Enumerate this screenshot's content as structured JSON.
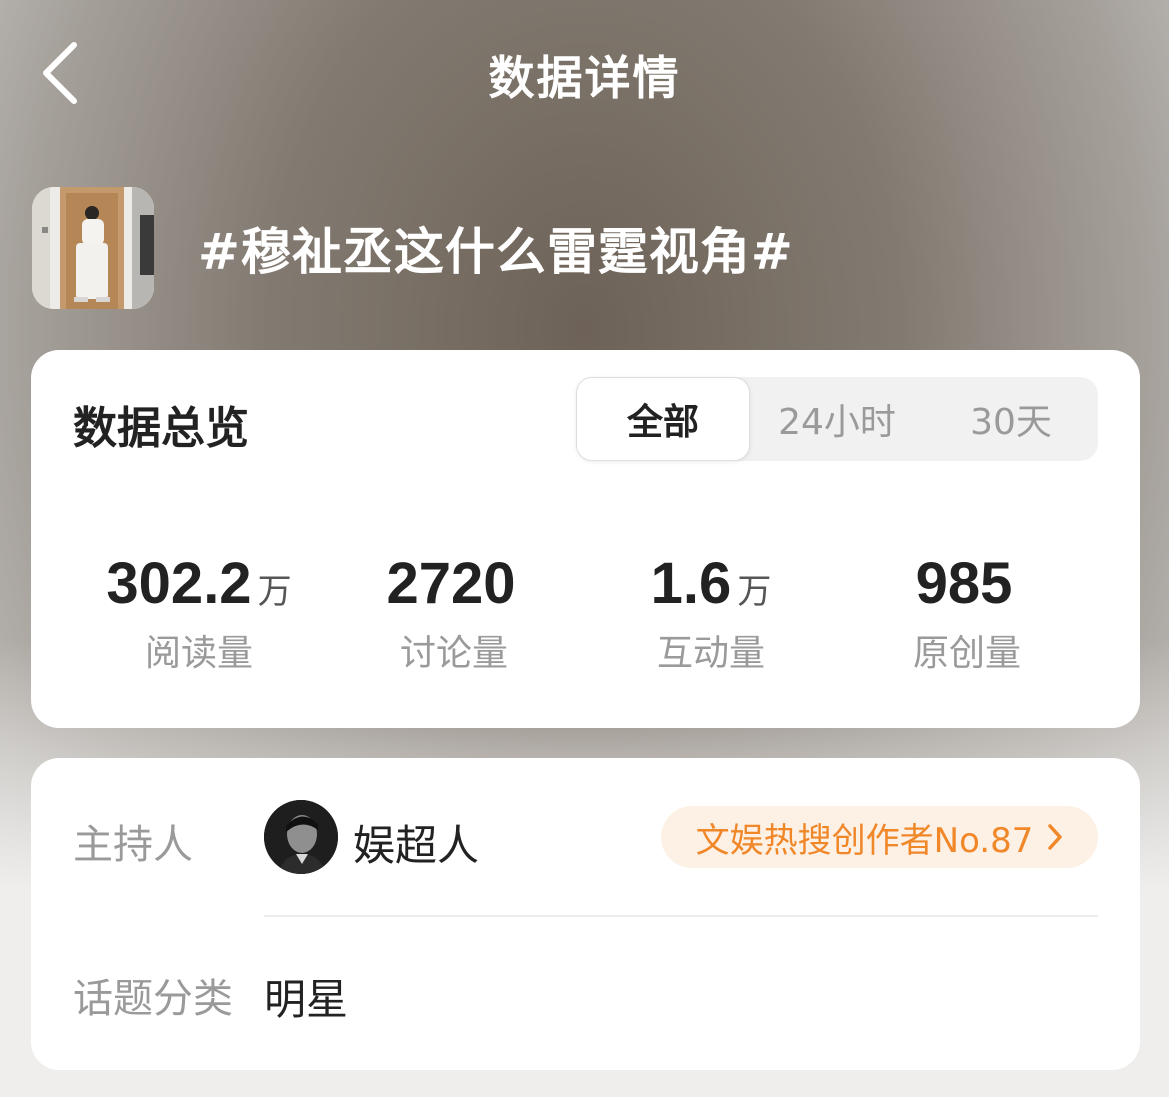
{
  "header": {
    "title": "数据详情",
    "back_icon": "chevron-left-icon"
  },
  "topic": {
    "title": "#穆祉丞这什么雷霆视角#"
  },
  "overview": {
    "title": "数据总览",
    "tabs": [
      {
        "label": "全部",
        "active": true
      },
      {
        "label": "24小时",
        "active": false
      },
      {
        "label": "30天",
        "active": false
      }
    ],
    "stats": [
      {
        "value": "302.2",
        "unit": "万",
        "label": "阅读量"
      },
      {
        "value": "2720",
        "unit": "",
        "label": "讨论量"
      },
      {
        "value": "1.6",
        "unit": "万",
        "label": "互动量"
      },
      {
        "value": "985",
        "unit": "",
        "label": "原创量"
      }
    ]
  },
  "info": {
    "host_label": "主持人",
    "host_name": "娱超人",
    "creator_badge": "文娱热搜创作者No.87",
    "category_label": "话题分类",
    "category_value": "明星"
  },
  "colors": {
    "accent_orange": "#f0882a",
    "badge_bg": "#fdf1e5",
    "text_primary": "#222222",
    "text_secondary": "#9a9a9a"
  }
}
